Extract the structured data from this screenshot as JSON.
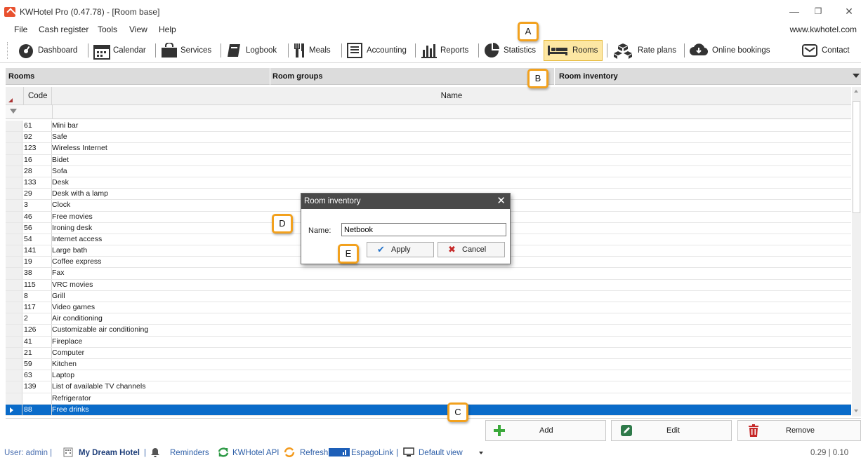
{
  "window": {
    "title": "KWHotel Pro (0.47.78) - [Room base]",
    "website": "www.kwhotel.com",
    "minimize": "—",
    "maximize": "❐",
    "close": "✕"
  },
  "menu": [
    "File",
    "Cash register",
    "Tools",
    "View",
    "Help"
  ],
  "toolbar": {
    "dashboard": "Dashboard",
    "calendar": "Calendar",
    "services": "Services",
    "logbook": "Logbook",
    "meals": "Meals",
    "accounting": "Accounting",
    "reports": "Reports",
    "statistics": "Statistics",
    "rooms": "Rooms",
    "rate_plans": "Rate plans",
    "online_bookings": "Online bookings",
    "contact": "Contact"
  },
  "tabs": {
    "rooms": "Rooms",
    "room_groups": "Room groups",
    "room_inventory": "Room inventory"
  },
  "grid": {
    "col_code": "Code",
    "col_name": "Name",
    "rows": [
      {
        "code": "61",
        "name": "Mini bar"
      },
      {
        "code": "92",
        "name": "Safe"
      },
      {
        "code": "123",
        "name": "Wireless Internet"
      },
      {
        "code": "16",
        "name": "Bidet"
      },
      {
        "code": "28",
        "name": "Sofa"
      },
      {
        "code": "133",
        "name": "Desk"
      },
      {
        "code": "29",
        "name": "Desk with a lamp"
      },
      {
        "code": "3",
        "name": "Clock"
      },
      {
        "code": "46",
        "name": "Free movies"
      },
      {
        "code": "56",
        "name": "Ironing desk"
      },
      {
        "code": "54",
        "name": "Internet access"
      },
      {
        "code": "141",
        "name": "Large bath"
      },
      {
        "code": "19",
        "name": "Coffee express"
      },
      {
        "code": "38",
        "name": "Fax"
      },
      {
        "code": "115",
        "name": "VRC movies"
      },
      {
        "code": "8",
        "name": "Grill"
      },
      {
        "code": "117",
        "name": "Video games"
      },
      {
        "code": "2",
        "name": "Air conditioning"
      },
      {
        "code": "126",
        "name": "Customizable air conditioning"
      },
      {
        "code": "41",
        "name": "Fireplace"
      },
      {
        "code": "21",
        "name": "Computer"
      },
      {
        "code": "59",
        "name": "Kitchen"
      },
      {
        "code": "63",
        "name": "Laptop"
      },
      {
        "code": "139",
        "name": "List of available TV channels"
      },
      {
        "code": "",
        "name": "Refrigerator"
      },
      {
        "code": "88",
        "name": "Free drinks"
      }
    ]
  },
  "buttons": {
    "add": "Add",
    "edit": "Edit",
    "remove": "Remove"
  },
  "dialog": {
    "title": "Room inventory",
    "close": "✕",
    "name_label": "Name:",
    "name_value": "Netbook",
    "apply": "Apply",
    "cancel": "Cancel"
  },
  "callouts": {
    "a": "A",
    "b": "B",
    "c": "C",
    "d": "D",
    "e": "E"
  },
  "status": {
    "user": "User: admin |",
    "hotel": "My Dream Hotel",
    "sep1": "|",
    "reminders": "Reminders",
    "api": "KWHotel API",
    "refresh": "Refresh",
    "espago": "EspagoLink",
    "sep2": "|",
    "default_view": "Default view",
    "right": "0.29 | 0.10"
  },
  "colors": {
    "accent": "#0a6bc9",
    "active_tab": "#fde7a3",
    "callout_border": "#f2a11e",
    "status_text": "#2e5fa8"
  }
}
